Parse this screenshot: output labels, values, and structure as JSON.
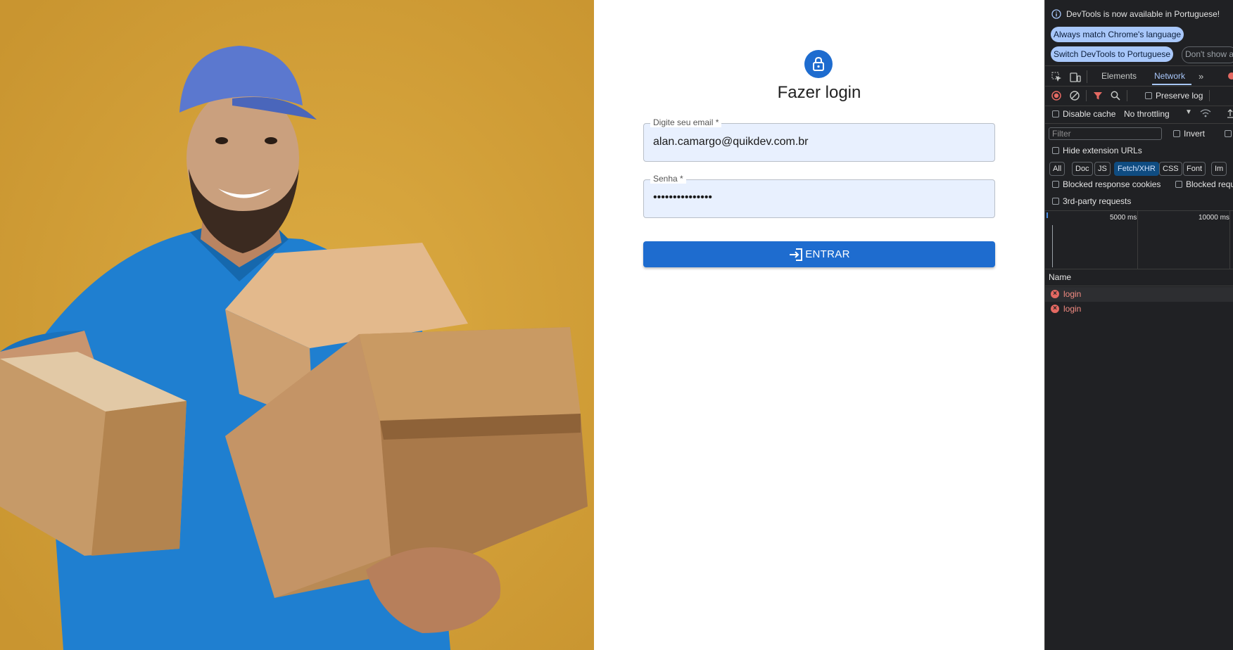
{
  "login": {
    "title": "Fazer login",
    "email": {
      "label": "Digite seu email *",
      "value": "alan.camargo@quikdev.com.br"
    },
    "password": {
      "label": "Senha *",
      "value": "•••••••••••••••"
    },
    "submit_label": "ENTRAR",
    "accent_color": "#1e6ccf"
  },
  "hero": {
    "background_color": "#d4a038",
    "description_icon": "delivery-man-photo"
  },
  "devtools": {
    "infobar_text": "DevTools is now available in Portuguese!",
    "btn_match_language": "Always match Chrome's language",
    "btn_switch_portuguese": "Switch DevTools to Portuguese",
    "btn_dont_show": "Don't show a",
    "tabs": {
      "elements": "Elements",
      "network": "Network"
    },
    "preserve_log": "Preserve log",
    "disable_cache": "Disable cache",
    "throttling": "No throttling",
    "filter_placeholder": "Filter",
    "invert": "Invert",
    "hide_extension_urls": "Hide extension URLs",
    "type_filters": [
      "All",
      "Doc",
      "JS",
      "Fetch/XHR",
      "CSS",
      "Font",
      "Im"
    ],
    "active_type_filter": "Fetch/XHR",
    "blocked_response_cookies": "Blocked response cookies",
    "blocked_requests": "Blocked requ",
    "third_party": "3rd-party requests",
    "timeline_ticks": [
      "5000 ms",
      "10000 ms"
    ],
    "name_header": "Name",
    "requests": [
      {
        "name": "login",
        "status": "error"
      },
      {
        "name": "login",
        "status": "error"
      }
    ]
  }
}
